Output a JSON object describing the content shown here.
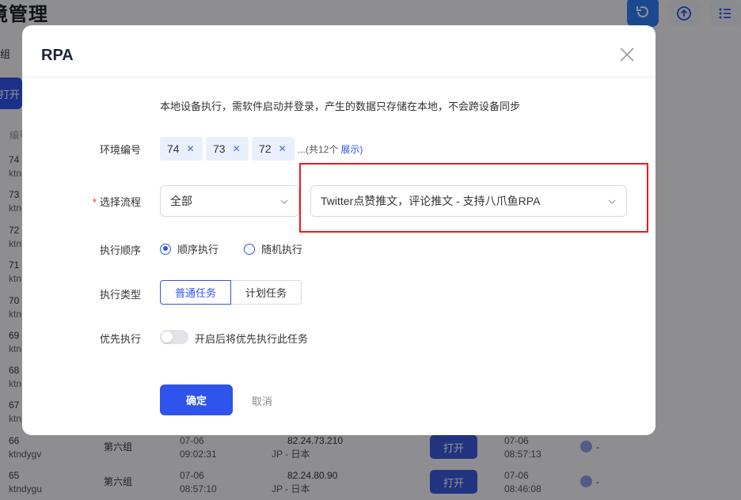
{
  "background": {
    "page_title": "境管理",
    "group_label": "组",
    "open_label": "打开",
    "column_header": "编号",
    "row_stubs": [
      {
        "id": "74",
        "code": "ktn"
      },
      {
        "id": "73",
        "code": "ktn"
      },
      {
        "id": "72",
        "code": "ktn"
      },
      {
        "id": "71",
        "code": "ktn"
      },
      {
        "id": "70",
        "code": "ktn"
      },
      {
        "id": "69",
        "code": "ktn"
      },
      {
        "id": "68",
        "code": "ktn"
      },
      {
        "id": "67",
        "code": "ktn"
      }
    ],
    "rows": [
      {
        "id": "66",
        "code": "ktndygv",
        "group": "第六组",
        "date1": "07-06",
        "time1": "09:02:31",
        "ip": "82.24.73.210",
        "region": "JP - 日本",
        "open": "打开",
        "date2": "07-06",
        "time2": "08:57:13",
        "dash": "-"
      },
      {
        "id": "65",
        "code": "ktndygu",
        "group": "第六组",
        "date1": "07-06",
        "time1": "08:57:10",
        "ip": "82.24.80.90",
        "region": "JP - 日本",
        "open": "打开",
        "date2": "07-06",
        "time2": "08:46:08",
        "dash": "-"
      }
    ]
  },
  "modal": {
    "title": "RPA",
    "notice": "本地设备执行，需软件启动并登录，产生的数据只存储在本地，不会跨设备同步",
    "env_label": "环境编号",
    "env_tags": [
      "74",
      "73",
      "72"
    ],
    "env_more": "...(共12个",
    "env_expand": "展示)",
    "flow_required_mark": "*",
    "flow_label": "选择流程",
    "flow_category": "全部",
    "flow_selected": "Twitter点赞推文，评论推文 - 支持八爪鱼RPA",
    "order_label": "执行顺序",
    "order_options": [
      "顺序执行",
      "随机执行"
    ],
    "type_label": "执行类型",
    "type_options": [
      "普通任务",
      "计划任务"
    ],
    "priority_label": "优先执行",
    "priority_hint": "开启后将优先执行此任务",
    "confirm_label": "确定",
    "cancel_label": "取消"
  },
  "colors": {
    "primary": "#2f54eb",
    "highlight": "#ec1a1a"
  }
}
